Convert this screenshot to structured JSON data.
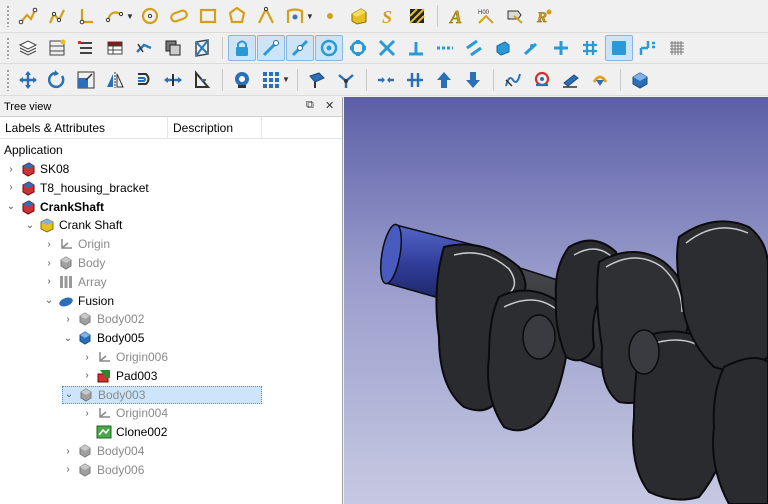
{
  "toolbar": {
    "row1": [
      "polyline-icon",
      "bspline-icon",
      "point-constraint-icon",
      "arc-icon",
      "circle-icon",
      "slot-icon",
      "rectangle-icon",
      "polygon-icon",
      "fillet-icon",
      "trim-icon",
      "point-icon",
      "shapestring-icon",
      "shapestring-s-icon",
      "hatch-icon",
      "annotation-text-icon",
      "label-icon",
      "dimension-icon",
      "layer-icon"
    ],
    "row2": [
      "layers-stack-icon",
      "grid-icon",
      "list-icon",
      "table-icon",
      "wire-icon",
      "clone-icon",
      "array-icon",
      "snap-lock-icon",
      "snap-endpoint-icon",
      "snap-midpoint-icon",
      "snap-center-icon",
      "snap-angle-icon",
      "snap-intersection-icon",
      "snap-perpendicular-icon",
      "snap-extension-icon",
      "snap-parallel-icon",
      "snap-special-icon",
      "snap-near-icon",
      "snap-ortho-icon",
      "snap-grid-icon",
      "snap-workingplane-icon",
      "snap-dimensions-icon",
      "toggle-grid-icon"
    ],
    "row3": [
      "move-icon",
      "rotate-icon",
      "scale-icon",
      "mirror-icon",
      "offset-icon",
      "stretch-icon",
      "trimex-icon",
      "view-icon",
      "array-grid-icon",
      "pointarray-icon",
      "pathtwist-icon",
      "split-icon",
      "join-icon",
      "upgrade-icon",
      "downgrade-icon",
      "wire-to-bspline-icon",
      "draft-to-sketch-icon",
      "shape2dview-icon",
      "heal-icon",
      "sketch-icon"
    ]
  },
  "tree_view": {
    "title": "Tree view",
    "col_labels": "Labels & Attributes",
    "col_description": "Description",
    "root": "Application",
    "items": [
      {
        "label": "SK08",
        "depth": 0,
        "expander": "›",
        "icon": "doc-icon",
        "muted": false,
        "bold": false
      },
      {
        "label": "T8_housing_bracket",
        "depth": 0,
        "expander": "›",
        "icon": "doc-icon",
        "muted": false,
        "bold": false
      },
      {
        "label": "CrankShaft",
        "depth": 0,
        "expander": "⌄",
        "icon": "doc-icon",
        "muted": false,
        "bold": true
      },
      {
        "label": "Crank Shaft",
        "depth": 1,
        "expander": "⌄",
        "icon": "part-icon",
        "muted": false,
        "bold": false
      },
      {
        "label": "Origin",
        "depth": 2,
        "expander": "›",
        "icon": "origin-icon",
        "muted": true,
        "bold": false
      },
      {
        "label": "Body",
        "depth": 2,
        "expander": "›",
        "icon": "body-icon",
        "muted": true,
        "bold": false
      },
      {
        "label": "Array",
        "depth": 2,
        "expander": "›",
        "icon": "array-icon",
        "muted": true,
        "bold": false
      },
      {
        "label": "Fusion",
        "depth": 2,
        "expander": "⌄",
        "icon": "fusion-icon",
        "muted": false,
        "bold": false
      },
      {
        "label": "Body002",
        "depth": 3,
        "expander": "›",
        "icon": "body-icon",
        "muted": true,
        "bold": false
      },
      {
        "label": "Body005",
        "depth": 3,
        "expander": "⌄",
        "icon": "body-active-icon",
        "muted": false,
        "bold": false
      },
      {
        "label": "Origin006",
        "depth": 4,
        "expander": "›",
        "icon": "origin-icon",
        "muted": true,
        "bold": false
      },
      {
        "label": "Pad003",
        "depth": 4,
        "expander": "›",
        "icon": "pad-icon",
        "muted": false,
        "bold": false
      },
      {
        "label": "Body003",
        "depth": 3,
        "expander": "⌄",
        "icon": "body-icon",
        "muted": true,
        "bold": false,
        "selected": true
      },
      {
        "label": "Origin004",
        "depth": 4,
        "expander": "›",
        "icon": "origin-icon",
        "muted": true,
        "bold": false
      },
      {
        "label": "Clone002",
        "depth": 4,
        "expander": "",
        "icon": "clone-icon",
        "muted": false,
        "bold": false
      },
      {
        "label": "Body004",
        "depth": 3,
        "expander": "›",
        "icon": "body-icon",
        "muted": true,
        "bold": false
      },
      {
        "label": "Body006",
        "depth": 3,
        "expander": "›",
        "icon": "body-icon",
        "muted": true,
        "bold": false
      }
    ]
  },
  "viewport": {
    "background_top": "#5c5fa6",
    "background_bottom": "#c7c9e2",
    "model_color": "#2e2f33",
    "shaft_end_color": "#3b4aa8"
  }
}
